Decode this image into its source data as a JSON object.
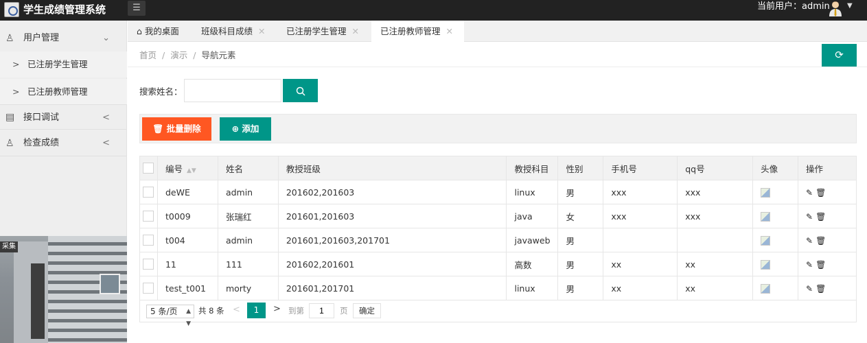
{
  "app": {
    "title": "学生成绩管理系统",
    "menu_icon": "hamburger-icon"
  },
  "header": {
    "current_user_label": "当前用户：admin",
    "avatar_icon": "user-avatar-icon"
  },
  "sidebar": {
    "items": [
      {
        "label": "用户管理",
        "icon": "user-icon",
        "expanded": true,
        "children": [
          {
            "label": "已注册学生管理"
          },
          {
            "label": "已注册教师管理"
          }
        ]
      },
      {
        "label": "接口调试",
        "icon": "document-icon"
      },
      {
        "label": "检查成绩",
        "icon": "user-icon"
      }
    ],
    "photo_badge": "采集"
  },
  "tabs": [
    {
      "label": "我的桌面",
      "icon": "home-icon"
    },
    {
      "label": "班级科目成绩"
    },
    {
      "label": "已注册学生管理"
    },
    {
      "label": "已注册教师管理",
      "active": true
    }
  ],
  "breadcrumb": {
    "items": [
      "首页",
      "演示",
      "导航元素"
    ]
  },
  "search": {
    "label": "搜索姓名：",
    "value": "",
    "placeholder": ""
  },
  "toolbar": {
    "batch_delete_label": "批量删除",
    "add_label": "添加"
  },
  "table": {
    "headers": [
      "编号",
      "姓名",
      "教授班级",
      "教授科目",
      "性别",
      "手机号",
      "qq号",
      "头像",
      "操作"
    ],
    "rows": [
      {
        "id": "deWE",
        "name": "admin",
        "classes": "201602,201603",
        "subject": "linux",
        "gender": "男",
        "phone": "xxx",
        "qq": "xxx"
      },
      {
        "id": "t0009",
        "name": "张瑞红",
        "classes": "201601,201603",
        "subject": "java",
        "gender": "女",
        "phone": "xxx",
        "qq": "xxx"
      },
      {
        "id": "t004",
        "name": "admin",
        "classes": "201601,201603,201701",
        "subject": "javaweb",
        "gender": "男",
        "phone": "",
        "qq": ""
      },
      {
        "id": "11",
        "name": "111",
        "classes": "201602,201601",
        "subject": "高数",
        "gender": "男",
        "phone": "xx",
        "qq": "xx"
      },
      {
        "id": "test_t001",
        "name": "morty",
        "classes": "201601,201701",
        "subject": "linux",
        "gender": "男",
        "phone": "xx",
        "qq": "xx"
      }
    ]
  },
  "pagination": {
    "page_size": "5 条/页",
    "total": "共 8 条",
    "current_page": "1",
    "goto_label": "到第",
    "goto_value": "1",
    "page_label": "页",
    "confirm_label": "确定"
  },
  "colors": {
    "primary": "#009688",
    "danger": "#ff5722",
    "topbar": "#222222"
  }
}
